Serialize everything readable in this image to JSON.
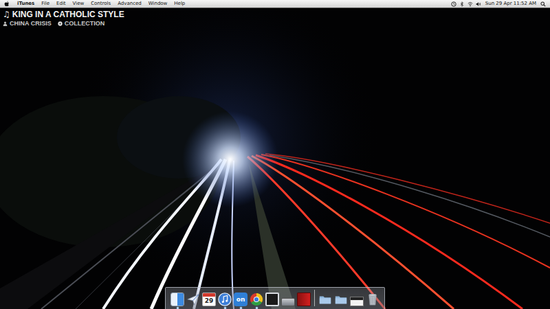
{
  "menu_bar": {
    "app_menu": "iTunes",
    "menus": [
      "File",
      "Edit",
      "View",
      "Controls",
      "Advanced",
      "Window",
      "Help"
    ],
    "clock": "Sun 29 Apr  11:52 AM"
  },
  "now_playing": {
    "note_icon": "♫",
    "track": "KING IN A CATHOLIC STYLE",
    "artist": "CHINA CRISIS",
    "album": "COLLECTION"
  },
  "dock": {
    "items": [
      {
        "kind": "finder",
        "running": true
      },
      {
        "kind": "send",
        "running": false
      },
      {
        "kind": "calendar",
        "label": "29",
        "running": false
      },
      {
        "kind": "itunes",
        "running": true
      },
      {
        "kind": "badge",
        "label": "on",
        "running": true
      },
      {
        "kind": "chrome",
        "running": true
      },
      {
        "kind": "terminal",
        "running": false
      },
      {
        "kind": "drive",
        "running": false
      },
      {
        "kind": "book",
        "running": false
      },
      {
        "kind": "separator",
        "running": false
      },
      {
        "kind": "folder",
        "running": false
      },
      {
        "kind": "folder",
        "running": false
      },
      {
        "kind": "window",
        "running": false
      },
      {
        "kind": "trash",
        "running": false
      }
    ]
  }
}
